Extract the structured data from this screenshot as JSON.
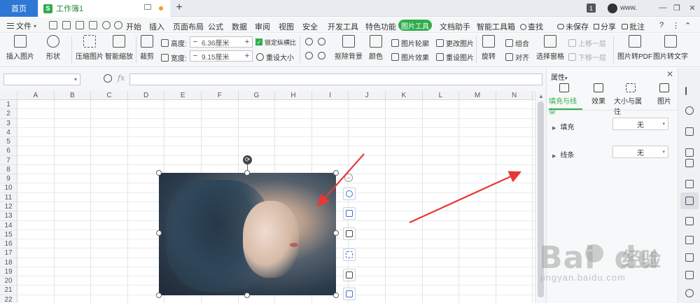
{
  "tabs": {
    "home": "首页",
    "doc_icon": "S",
    "doc_title": "工作簿1",
    "add": "+",
    "badge": "1",
    "user": "www.",
    "min": "—",
    "restore": "❐",
    "close": "✕"
  },
  "menu": {
    "file": "文件",
    "file_caret": "▾",
    "items": [
      "开始",
      "插入",
      "页面布局",
      "公式",
      "数据",
      "审阅",
      "视图",
      "安全",
      "开发工具",
      "特色功能"
    ],
    "active": "图片工具",
    "items_right": [
      "文档助手",
      "智能工具箱"
    ],
    "search": "查找",
    "unsaved": "未保存",
    "share": "分享",
    "annotate": "批注",
    "help": "?"
  },
  "ribbon": {
    "insert_picture": "插入图片",
    "shape": "形状",
    "compress": "压缩图片",
    "smart_zoom": "智能缩放",
    "crop": "裁剪",
    "height_label": "高度:",
    "height_value": "6.36厘米",
    "width_label": "宽度:",
    "width_value": "9.15厘米",
    "lock_ratio": "锁定纵横比",
    "reset_size": "重设大小",
    "remove_bg": "抠除背景",
    "color": "颜色",
    "outline": "图片轮廓",
    "effects": "图片效果",
    "change_pic": "更改图片",
    "reset_pic": "重设图片",
    "rotate": "旋转",
    "group": "组合",
    "align": "对齐",
    "selection_pane": "选择窗格",
    "bring_forward": "上移一层",
    "send_backward": "下移一层",
    "to_pdf": "图片转PDF",
    "to_text": "图片转文字",
    "minus": "−",
    "plus": "+"
  },
  "formula": {
    "fx": "fx"
  },
  "sheet": {
    "columns": [
      "A",
      "B",
      "C",
      "D",
      "E",
      "F",
      "G",
      "H",
      "I",
      "J",
      "K",
      "L",
      "M",
      "N"
    ],
    "rows": [
      "1",
      "2",
      "3",
      "4",
      "5",
      "6",
      "7",
      "8",
      "9",
      "10",
      "11",
      "12",
      "13",
      "14",
      "15",
      "16",
      "17",
      "18",
      "19",
      "20",
      "21",
      "22"
    ]
  },
  "panel": {
    "title": "属性",
    "title_caret": "▾",
    "close": "✕",
    "tabs": [
      "填充与线条",
      "效果",
      "大小与属性",
      "图片"
    ],
    "fill_label": "填充",
    "fill_value": "无",
    "line_label": "线条",
    "line_value": "无"
  },
  "watermark": {
    "text": "Bai",
    "text2": "du",
    "cn": "经验",
    "url": "jingyan.baidu.com"
  },
  "colors": {
    "accent_green": "#2fae4b",
    "tab_blue": "#2f77d4",
    "arrow_red": "#e53935"
  }
}
